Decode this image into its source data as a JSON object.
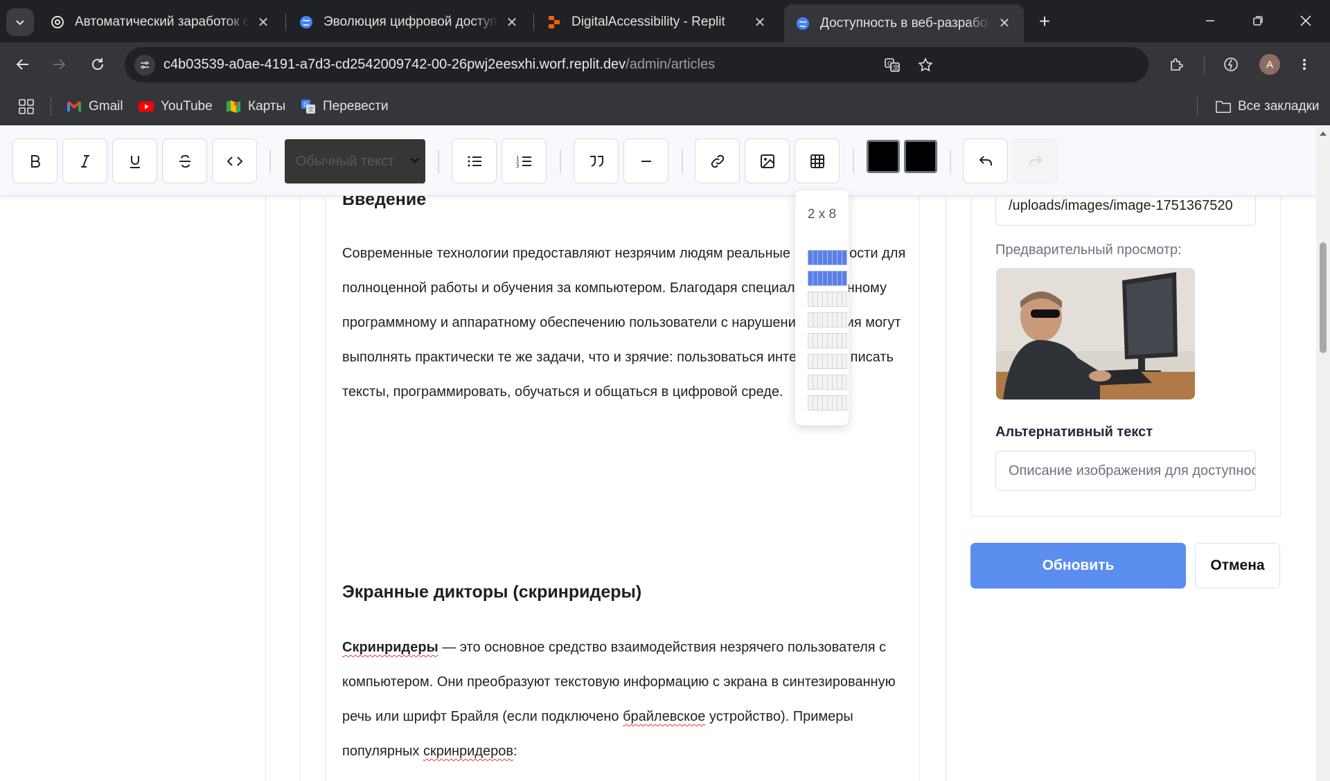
{
  "browser": {
    "tabs": [
      {
        "title": "Автоматический заработок с ChatGPT",
        "favicon": "openai-icon"
      },
      {
        "title": "Эволюция цифровой доступности",
        "favicon": "globe-icon"
      },
      {
        "title": "DigitalAccessibility - Replit",
        "favicon": "replit-icon"
      },
      {
        "title": "Доступность в веб-разработке",
        "favicon": "globe-icon",
        "active": true
      }
    ],
    "address": {
      "host": "c4b03539-a0ae-4191-a7d3-cd2542009742-00-26pwj2eesxhi.worf.replit.dev",
      "path": "/admin/articles"
    },
    "profile_initial": "A",
    "bookmarks": [
      {
        "label": "Gmail",
        "icon": "gmail-icon"
      },
      {
        "label": "YouTube",
        "icon": "youtube-icon"
      },
      {
        "label": "Карты",
        "icon": "maps-icon"
      },
      {
        "label": "Перевести",
        "icon": "translate-icon"
      }
    ],
    "all_bookmarks_label": "Все закладки"
  },
  "editor": {
    "toolbar": {
      "text_style": "Обычный текст",
      "text_color": "#000000",
      "highlight_color": "#000000"
    },
    "table_picker": {
      "size_label": "2 x 8",
      "rows": 8,
      "cols": 8,
      "selected_rows": 2
    },
    "content": {
      "h_intro": "Введение",
      "p_intro": "Современные технологии предоставляют незрячим людям реальные возможности для полноценной работы и обучения за компьютером. Благодаря специализированному программному и аппаратному обеспечению пользователи с нарушением зрения могут выполнять практически те же задачи, что и зрячие: пользоваться интернетом, писать тексты, программировать, обучаться и общаться в цифровой среде.",
      "h_screenreaders": "Экранные дикторы (скринридеры)",
      "sr_term": "Скринридеры",
      "sr_text": " — это основное средство взаимодействия незрячего пользователя с компьютером. Они преобразуют текстовую информацию с экрана в синтезированную речь или шрифт Брайля (если подключено ",
      "sr_braille": "брайлевское",
      "sr_text2": " устройство). Примеры популярных ",
      "sr_examples": "скринридеров",
      "sr_colon": ":"
    }
  },
  "sidebar": {
    "image_url": "/uploads/images/image-1751367520",
    "preview_label": "Предварительный просмотр:",
    "alt_label": "Альтернативный текст",
    "alt_placeholder": "Описание изображения для доступности",
    "update_button": "Обновить",
    "cancel_button": "Отмена"
  },
  "colors": {
    "primary": "#5b8def",
    "grid_selected": "#5b7fe6",
    "chrome_bg": "#202124"
  }
}
